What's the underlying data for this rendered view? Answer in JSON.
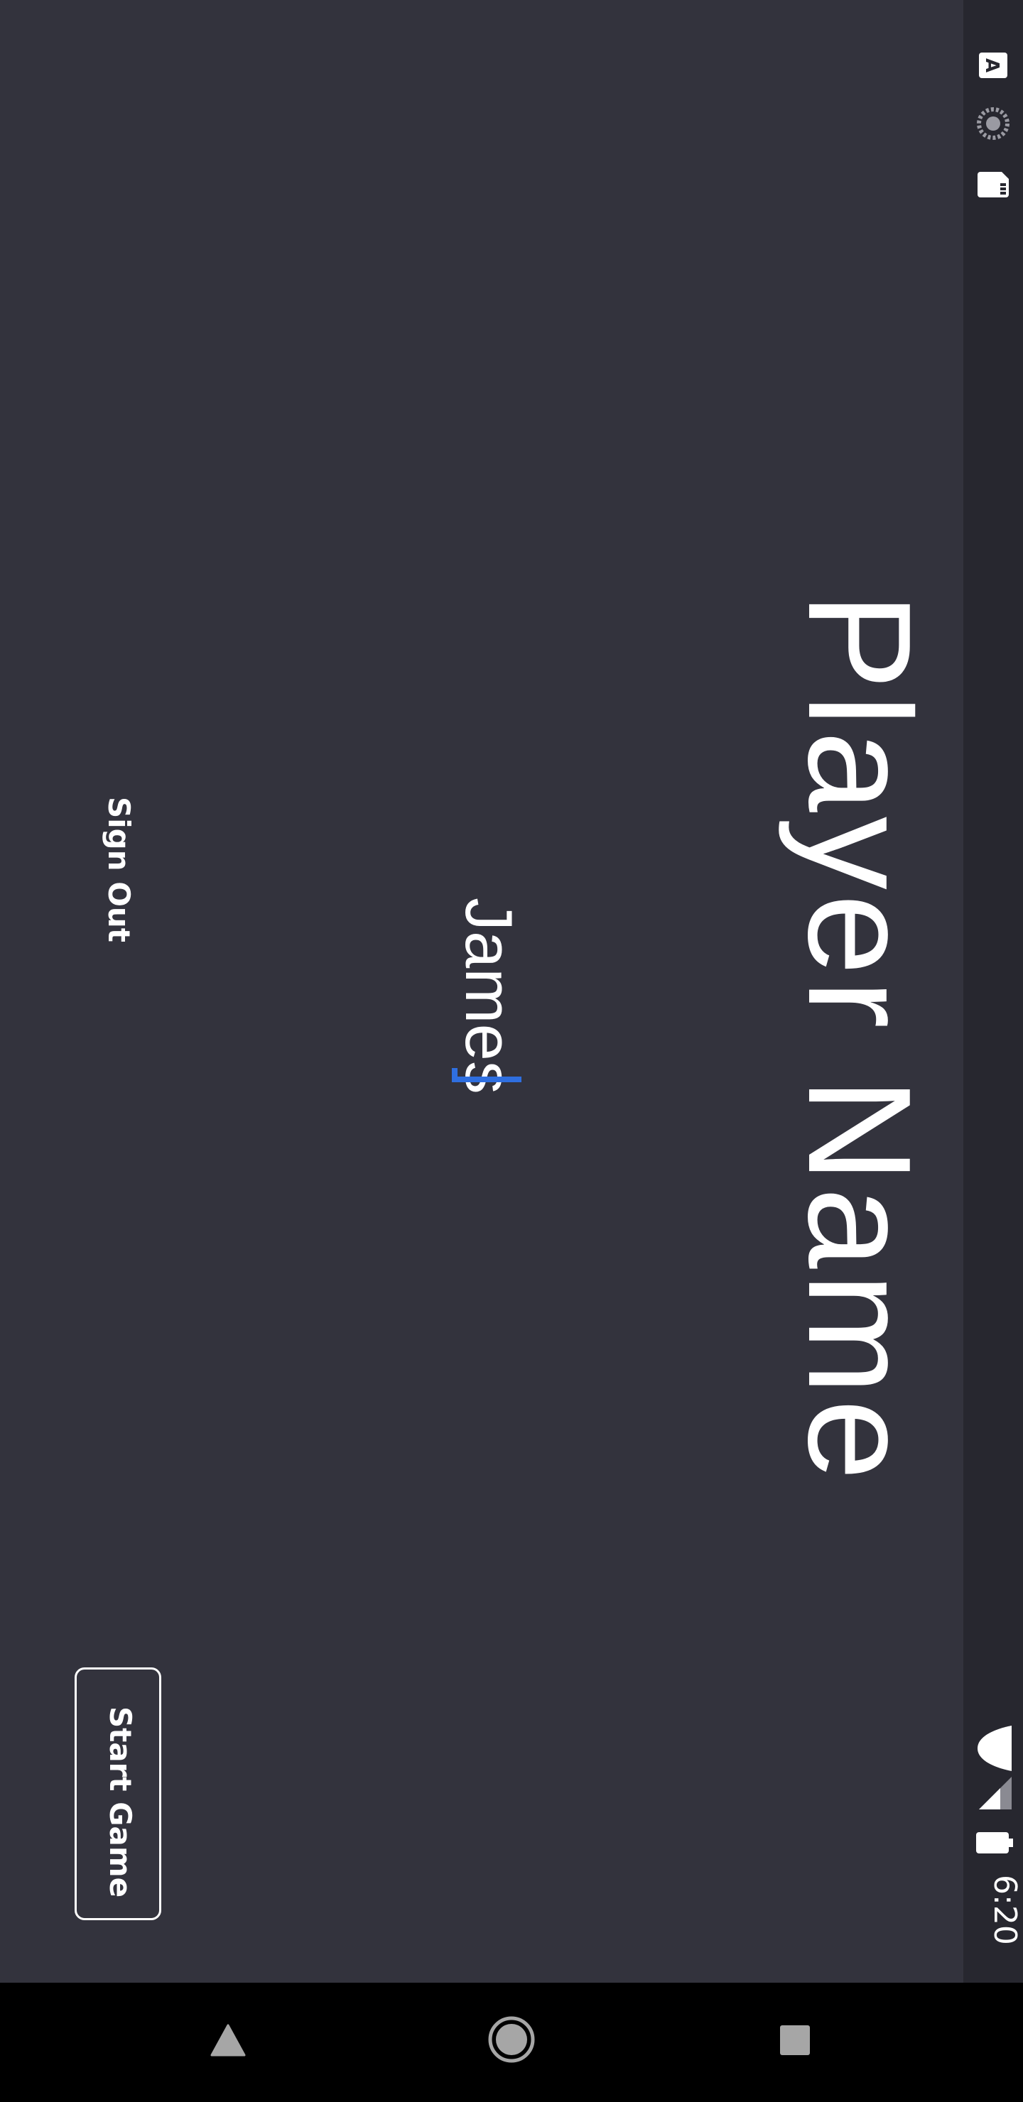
{
  "screen": {
    "title": "Player Name",
    "player_name_value": "James",
    "sign_out_label": "Sign Out",
    "start_game_label": "Start Game"
  },
  "status_bar": {
    "time": "6:20"
  },
  "icons": {
    "status_left": [
      "wifi-icon",
      "signal-icon",
      "battery-icon"
    ],
    "status_right": [
      "a-icon",
      "sync-icon",
      "sd-card-icon"
    ],
    "nav": [
      "back-icon",
      "home-icon",
      "recents-icon"
    ]
  },
  "colors": {
    "background": "#33333d",
    "status_bar": "#27272f",
    "nav_bar": "#000000",
    "accent": "#2f6fe0",
    "text": "#ffffff"
  }
}
